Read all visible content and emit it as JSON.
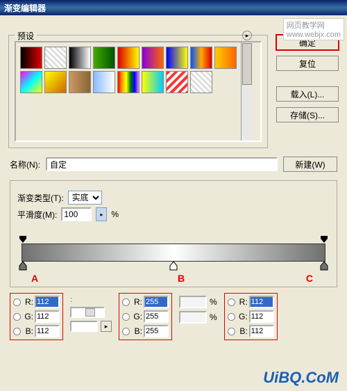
{
  "title": "渐变编辑器",
  "watermarkTop": "网页教学网\nwww.webjx.com",
  "presetsLegend": "预设",
  "buttons": {
    "ok": "确定",
    "reset": "复位",
    "load": "载入(L)...",
    "save": "存储(S)...",
    "new": "新建(W)"
  },
  "nameLabel": "名称(N):",
  "nameValue": "自定",
  "typeLabel": "渐变类型(T):",
  "typeValue": "实底",
  "smoothLabel": "平滑度(M):",
  "smoothValue": "100",
  "percent": "%",
  "stopLabels": {
    "a": "A",
    "b": "B",
    "c": "C"
  },
  "rgb": {
    "a": {
      "r": "112",
      "g": "112",
      "b": "112"
    },
    "b": {
      "r": "255",
      "g": "255",
      "b": "255"
    },
    "c": {
      "r": "112",
      "g": "112",
      "b": "112"
    }
  },
  "rgbLabels": {
    "r": "R:",
    "g": "G:",
    "b": "B:"
  },
  "watermarkBottom": "UiBQ.CoM",
  "swatches": [
    "linear-gradient(90deg,#000,#d00)",
    "linear-gradient(45deg,#fff 25%,#ddd 25%,#ddd 50%,#fff 50%,#fff 75%,#ddd 75%)",
    "linear-gradient(90deg,#000,#fff)",
    "linear-gradient(90deg,#4a0,#005500)",
    "linear-gradient(90deg,#d00,#ff0)",
    "linear-gradient(90deg,#80d,#f60)",
    "linear-gradient(90deg,#00f,#ff0)",
    "linear-gradient(90deg,#05f,#fa0,#d00)",
    "linear-gradient(90deg,#fc0,#f60)",
    "linear-gradient(135deg,#f0f,#0ff,#ff0)",
    "linear-gradient(135deg,#ff0,#c60)",
    "linear-gradient(90deg,#c96,#863)",
    "linear-gradient(90deg,#8bf,#fff)",
    "linear-gradient(90deg,red,orange,yellow,green,blue,violet)",
    "linear-gradient(90deg,#ff0,#0cf)",
    "repeating-linear-gradient(135deg,#f33 0 4px,#fff 4px 8px)",
    "linear-gradient(45deg,#fff 25%,#ddd 25%,#ddd 50%,#fff 50%,#fff 75%,#ddd 75%)"
  ]
}
